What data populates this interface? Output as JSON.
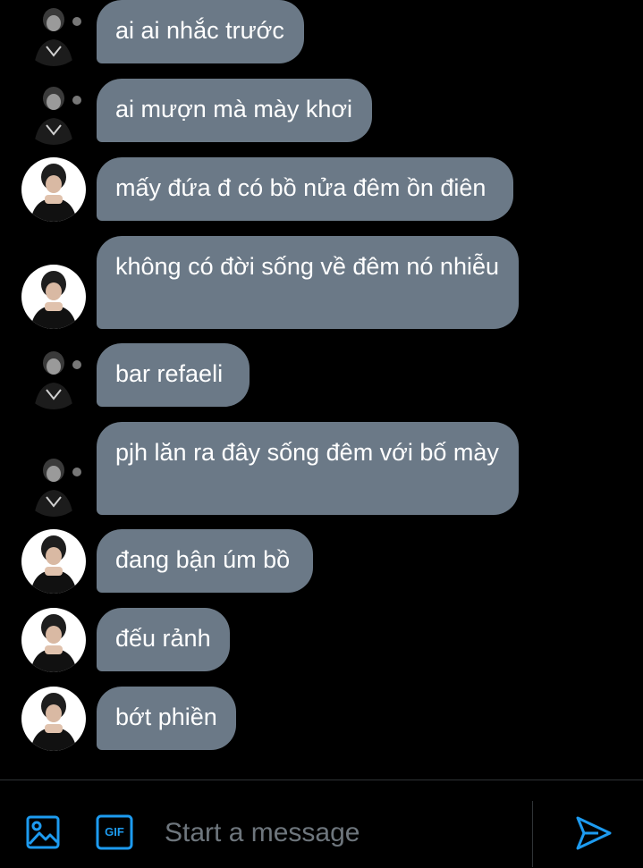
{
  "colors": {
    "background": "#000000",
    "bubble": "#6b7987",
    "accent": "#1d9bf0",
    "placeholder": "#6e767d"
  },
  "messages": [
    {
      "text": "ai ai nhắc trước",
      "avatar": "dark-avatar"
    },
    {
      "text": "ai mượn mà mày khơi",
      "avatar": "dark-avatar"
    },
    {
      "text": "mấy đứa đ có bồ nửa đêm ồn điên",
      "avatar": "light-avatar"
    },
    {
      "text": "không có đời sống về đêm nó nhiễu",
      "avatar": "light-avatar"
    },
    {
      "text": "bar refaeli",
      "avatar": "dark-avatar"
    },
    {
      "text": "pjh lăn ra đây sống đêm với bố mày",
      "avatar": "dark-avatar"
    },
    {
      "text": "đang bận úm bồ",
      "avatar": "light-avatar"
    },
    {
      "text": "đếu rảnh",
      "avatar": "light-avatar"
    },
    {
      "text": "bớt phiền",
      "avatar": "light-avatar"
    }
  ],
  "composer": {
    "placeholder": "Start a message",
    "gif_label": "GIF",
    "icons": [
      "image-icon",
      "gif-icon",
      "send-icon"
    ]
  }
}
